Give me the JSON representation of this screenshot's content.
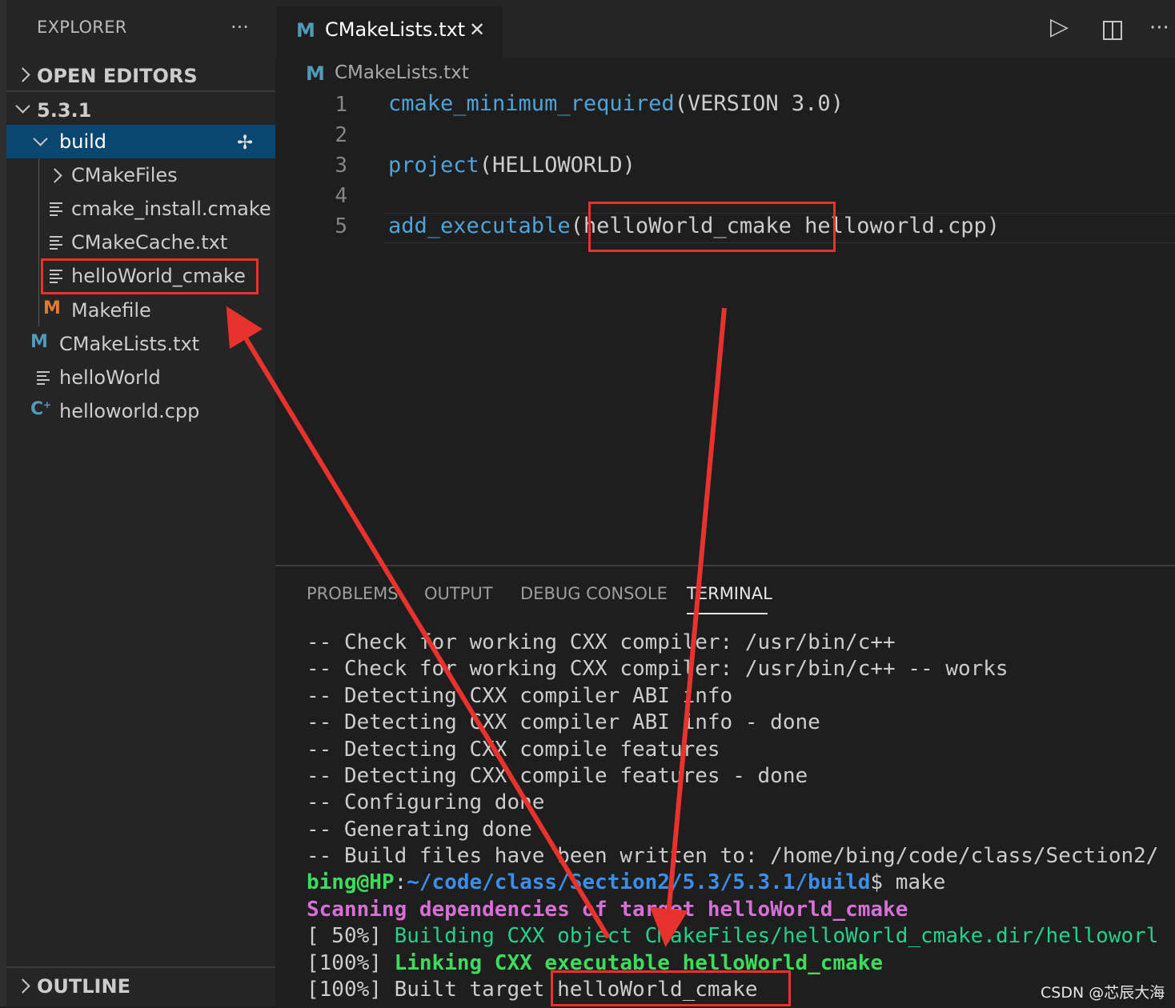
{
  "sidebar": {
    "title": "EXPLORER",
    "more": "···",
    "open_editors": "OPEN EDITORS",
    "folder": "5.3.1",
    "items": [
      {
        "label": "build"
      },
      {
        "label": "CMakeFiles"
      },
      {
        "label": "cmake_install.cmake"
      },
      {
        "label": "CMakeCache.txt"
      },
      {
        "label": "helloWorld_cmake"
      },
      {
        "label": "Makefile"
      },
      {
        "label": "CMakeLists.txt"
      },
      {
        "label": "helloWorld"
      },
      {
        "label": "helloworld.cpp"
      }
    ],
    "outline": "OUTLINE"
  },
  "editor": {
    "tab": {
      "icon": "M",
      "label": "CMakeLists.txt",
      "close": "✕"
    },
    "breadcrumb": {
      "icon": "M",
      "label": "CMakeLists.txt"
    },
    "actions": {
      "run": "▷",
      "more": "···"
    },
    "lines": [
      {
        "num": "1",
        "fn": "cmake_minimum_required",
        "rest": "(VERSION 3.0)"
      },
      {
        "num": "2",
        "fn": "",
        "rest": ""
      },
      {
        "num": "3",
        "fn": "project",
        "rest": "(HELLOWORLD)"
      },
      {
        "num": "4",
        "fn": "",
        "rest": ""
      },
      {
        "num": "5",
        "fn": "add_executable",
        "rest": "(helloWorld_cmake helloworld.cpp)"
      }
    ]
  },
  "panel": {
    "tabs": [
      "PROBLEMS",
      "OUTPUT",
      "DEBUG CONSOLE",
      "TERMINAL"
    ],
    "active_tab": "TERMINAL",
    "terminal": {
      "lines": [
        "-- Check for working CXX compiler: /usr/bin/c++",
        "-- Check for working CXX compiler: /usr/bin/c++ -- works",
        "-- Detecting CXX compiler ABI info",
        "-- Detecting CXX compiler ABI info - done",
        "-- Detecting CXX compile features",
        "-- Detecting CXX compile features - done",
        "-- Configuring done",
        "-- Generating done",
        "-- Build files have been written to: /home/bing/code/class/Section2/"
      ],
      "prompt_user": "bing@HP",
      "prompt_path": "~/code/class/Section2/5.3/5.3.1/build",
      "prompt_cmd": "$ make",
      "scan_line": "Scanning dependencies of target helloWorld_cmake",
      "build_prefix": "[ 50%] ",
      "build_text": "Building CXX object CMakeFiles/helloWorld_cmake.dir/helloworl",
      "link_prefix": "[100%] ",
      "link_text": "Linking CXX executable helloWorld_cmake",
      "built_line": "[100%] Built target helloWorld_cmake"
    }
  },
  "watermark": "CSDN @芯辰大海",
  "colors": {
    "annotation_red": "#e8322e",
    "selection": "#094771",
    "keyword": "#4fa3d9"
  }
}
